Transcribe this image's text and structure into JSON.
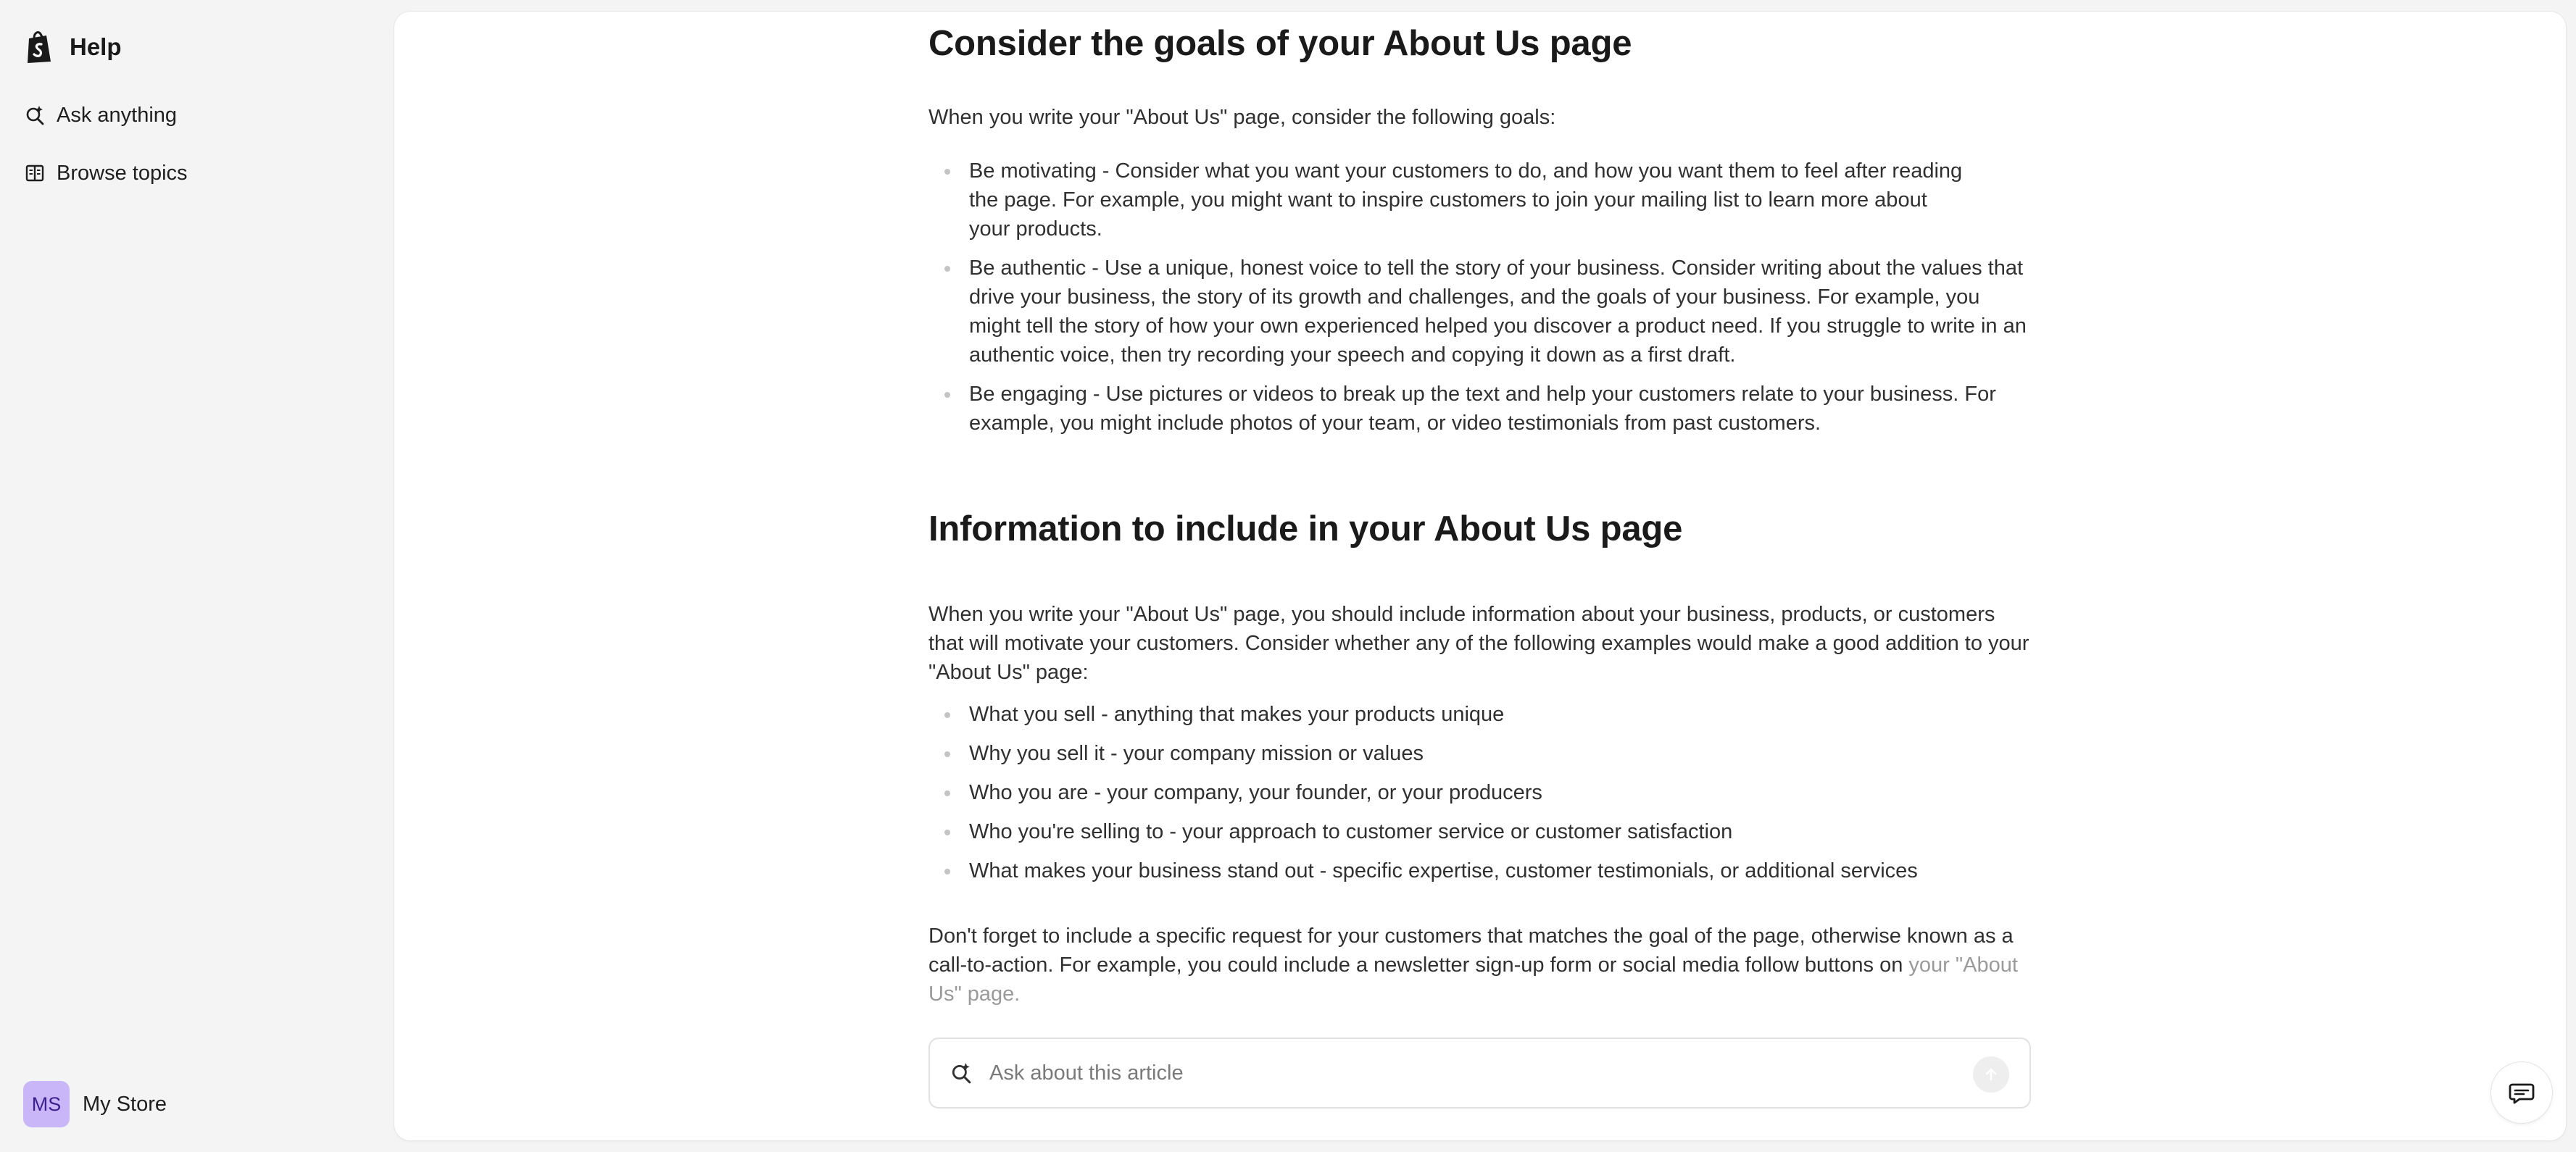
{
  "sidebar": {
    "brand": {
      "title": "Help",
      "icon": "shopify-bag-icon"
    },
    "nav": [
      {
        "label": "Ask anything",
        "icon": "search-sparkle-icon"
      },
      {
        "label": "Browse topics",
        "icon": "book-icon"
      }
    ],
    "store": {
      "initials": "MS",
      "name": "My Store"
    }
  },
  "article": {
    "goals": {
      "heading": "Consider the goals of your About Us page",
      "intro": "When you write your \"About Us\" page, consider the following goals:",
      "items": [
        "Be motivating - Consider what you want your customers to do, and how you want them to feel after reading the page. For example, you might want to inspire customers to join your mailing list to learn more about your products.",
        "Be authentic - Use a unique, honest voice to tell the story of your business. Consider writing about the values that drive your business, the story of its growth and challenges, and the goals of your business. For example, you might tell the story of how your own experienced helped you discover a product need. If you struggle to write in an authentic voice, then try recording your speech and copying it down as a first draft.",
        "Be engaging - Use pictures or videos to break up the text and help your customers relate to your business. For example, you might include photos of your team, or video testimonials from past customers."
      ]
    },
    "info": {
      "heading": "Information to include in your About Us page",
      "intro": "When you write your \"About Us\" page, you should include information about your business, products, or customers that will motivate your customers. Consider whether any of the following examples would make a good addition to your \"About Us\" page:",
      "items": [
        "What you sell - anything that makes your products unique",
        "Why you sell it - your company mission or values",
        "Who you are - your company, your founder, or your producers",
        "Who you're selling to - your approach to customer service or customer satisfaction",
        "What makes your business stand out - specific expertise, customer testimonials, or additional services"
      ],
      "cta_main": "Don't forget to include a specific request for your customers that matches the goal of the page, otherwise known as a call-to-action. For example, you could include a newsletter sign-up form or social media follow buttons on",
      "cta_faded": "your \"About Us\" page."
    }
  },
  "ask_box": {
    "placeholder": "Ask about this article",
    "icon": "search-sparkle-icon",
    "send_icon": "arrow-up-icon"
  },
  "chat_button": {
    "icon": "chat-icon"
  },
  "colors": {
    "page_bg": "#f4f4f4",
    "panel_bg": "#ffffff",
    "avatar_bg": "#c9b6f8",
    "text": "#303030",
    "bullet": "#c4c4c4"
  }
}
